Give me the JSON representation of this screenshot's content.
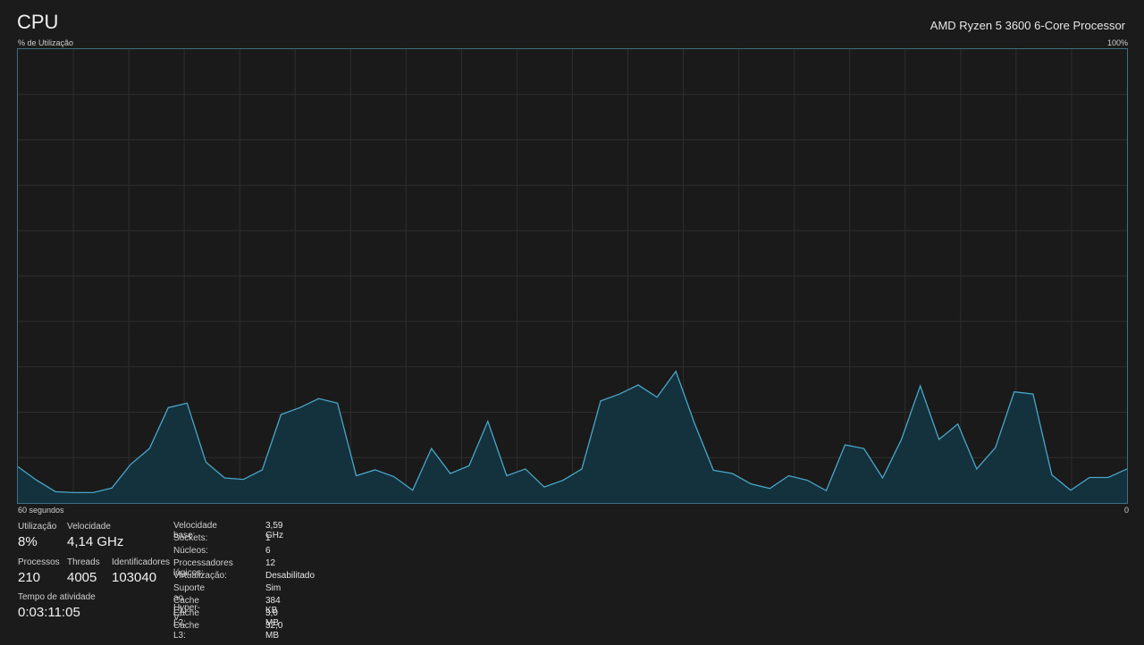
{
  "header": {
    "title": "CPU",
    "processor": "AMD Ryzen 5 3600 6-Core Processor"
  },
  "graph": {
    "ylabel": "% de Utilização",
    "ymax_label": "100%",
    "xleft_label": "60 segundos",
    "xright_label": "0",
    "line_color": "#4aa6c8",
    "fill_color": "#13323d",
    "grid_color": "#2e2e2e"
  },
  "chart_data": {
    "type": "area",
    "ylim": [
      0,
      100
    ],
    "grid": true,
    "values": [
      8,
      5,
      2.5,
      2.3,
      2.3,
      3.3,
      8.5,
      12,
      21,
      22,
      9,
      5.5,
      5.2,
      7.3,
      19.5,
      21,
      23,
      22,
      6,
      7.3,
      5.8,
      2.8,
      12,
      6.5,
      8.2,
      18,
      6,
      7.5,
      3.5,
      5,
      7.5,
      22.5,
      24,
      26,
      23.3,
      29,
      17.5,
      7.2,
      6.5,
      4.2,
      3.2,
      6,
      5,
      2.7,
      12.8,
      12,
      5.5,
      14,
      25.8,
      14,
      17.4,
      7.5,
      12.2,
      24.5,
      24,
      6.2,
      2.8,
      5.6,
      5.6,
      7.5
    ]
  },
  "stats": {
    "utilizacao": {
      "label": "Utilização",
      "value": "8%"
    },
    "velocidade": {
      "label": "Velocidade",
      "value": "4,14 GHz"
    },
    "processos": {
      "label": "Processos",
      "value": "210"
    },
    "threads": {
      "label": "Threads",
      "value": "4005"
    },
    "identificadores": {
      "label": "Identificadores",
      "value": "103040"
    },
    "tempo": {
      "label": "Tempo de atividade",
      "value": "0:03:11:05"
    }
  },
  "details": [
    {
      "key": "Velocidade base:",
      "value": "3,59 GHz"
    },
    {
      "key": "Sockets:",
      "value": "1"
    },
    {
      "key": "Núcleos:",
      "value": "6"
    },
    {
      "key": "Processadores lógicos:",
      "value": "12"
    },
    {
      "key": "Virtualização:",
      "value": "Desabilitado"
    },
    {
      "key": "Suporte ao Hyper-V:",
      "value": "Sim"
    },
    {
      "key": "Cache L1:",
      "value": "384 KB"
    },
    {
      "key": "Cache L2:",
      "value": "3,0 MB"
    },
    {
      "key": "Cache L3:",
      "value": "32,0 MB"
    }
  ]
}
